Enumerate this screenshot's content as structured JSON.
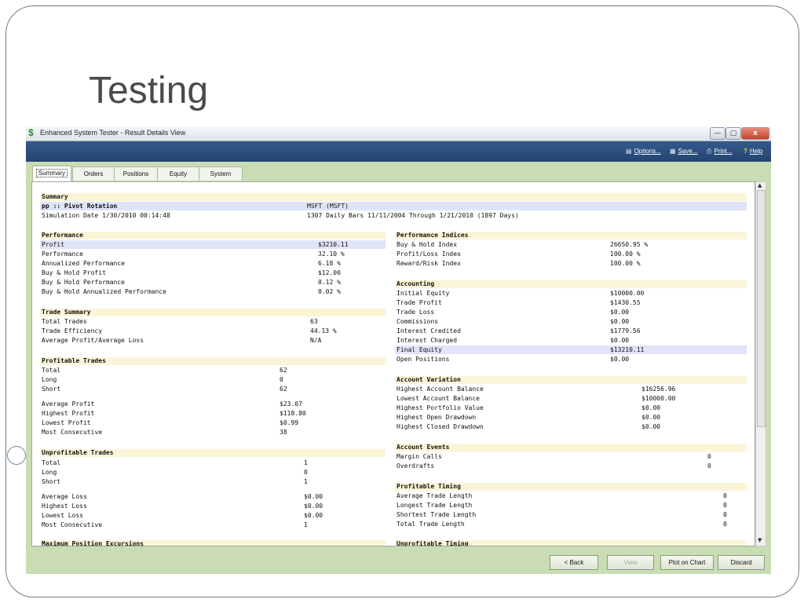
{
  "slide": {
    "title": "Testing"
  },
  "window": {
    "title": "Enhanced System Tester - Result Details View",
    "app_icon": "$",
    "buttons": {
      "minimize": "—",
      "maximize": "▢",
      "close": "x"
    }
  },
  "toolbar": {
    "options": "Options...",
    "save": "Save...",
    "print": "Print...",
    "help": "Help"
  },
  "tabs": [
    "Summary",
    "Orders",
    "Positions",
    "Equity",
    "System"
  ],
  "summary": {
    "header": "Summary",
    "system_name": "pp :: Pivot Rotation",
    "symbol": "MSFT (MSFT)",
    "sim_date": "Simulation Date 1/30/2010 00:14:48",
    "bars": "1307 Daily Bars 11/11/2004 Through 1/21/2010 (1897 Days)"
  },
  "left": {
    "performance": {
      "header": "Performance",
      "rows": [
        {
          "label": "Profit",
          "value": "$3210.11"
        },
        {
          "label": "Performance",
          "value": "32.10 %"
        },
        {
          "label": "Annualized Performance",
          "value": "6.18 %"
        },
        {
          "label": "Buy & Hold Profit",
          "value": "$12.00"
        },
        {
          "label": "Buy & Hold Performance",
          "value": "0.12 %"
        },
        {
          "label": "Buy & Hold Annualized Performance",
          "value": "0.02 %"
        }
      ]
    },
    "trade_summary": {
      "header": "Trade Summary",
      "rows": [
        {
          "label": "Total Trades",
          "value": "63"
        },
        {
          "label": "Trade Efficiency",
          "value": "44.13 %"
        },
        {
          "label": "Average Profit/Average Loss",
          "value": "N/A"
        }
      ]
    },
    "profitable_trades": {
      "header": "Profitable Trades",
      "rows": [
        {
          "label": "Total",
          "value": "62"
        },
        {
          "label": "Long",
          "value": "0"
        },
        {
          "label": "Short",
          "value": "62"
        },
        {
          "label": "Average Profit",
          "value": "$23.07"
        },
        {
          "label": "Highest Profit",
          "value": "$118.80"
        },
        {
          "label": "Lowest Profit",
          "value": "$0.99"
        },
        {
          "label": "Most Consecutive",
          "value": "38"
        }
      ]
    },
    "unprofitable_trades": {
      "header": "Unprofitable Trades",
      "rows": [
        {
          "label": "Total",
          "value": "1"
        },
        {
          "label": "Long",
          "value": "0"
        },
        {
          "label": "Short",
          "value": "1"
        },
        {
          "label": "Average Loss",
          "value": "$0.00"
        },
        {
          "label": "Highest Loss",
          "value": "$0.00"
        },
        {
          "label": "Lowest Loss",
          "value": "$0.00"
        },
        {
          "label": "Most Consecutive",
          "value": "1"
        }
      ]
    },
    "cut_header": "Maximum Position Excursions"
  },
  "right": {
    "performance_indices": {
      "header": "Performance Indices",
      "rows": [
        {
          "label": "Buy & Hold Index",
          "value": "26650.95 %"
        },
        {
          "label": "Profit/Loss Index",
          "value": "100.00 %"
        },
        {
          "label": "Reward/Risk Index",
          "value": "100.00 %"
        }
      ]
    },
    "accounting": {
      "header": "Accounting",
      "rows": [
        {
          "label": "Initial Equity",
          "value": "$10000.00"
        },
        {
          "label": "Trade Profit",
          "value": "$1430.55"
        },
        {
          "label": "Trade Loss",
          "value": "$0.00"
        },
        {
          "label": "Commissions",
          "value": "$0.00"
        },
        {
          "label": "Interest Credited",
          "value": "$1779.56"
        },
        {
          "label": "Interest Charged",
          "value": "$0.00"
        },
        {
          "label": "Final Equity",
          "value": "$13210.11"
        },
        {
          "label": "Open Positions",
          "value": "$0.00"
        }
      ]
    },
    "account_variation": {
      "header": "Account Variation",
      "rows": [
        {
          "label": "Highest Account Balance",
          "value": "$16256.96"
        },
        {
          "label": "Lowest Account Balance",
          "value": "$10000.00"
        },
        {
          "label": "Highest Portfolio Value",
          "value": "$0.00"
        },
        {
          "label": "Highest Open Drawdown",
          "value": "$0.00"
        },
        {
          "label": "Highest Closed Drawdown",
          "value": "$0.00"
        }
      ]
    },
    "account_events": {
      "header": "Account Events",
      "rows": [
        {
          "label": "Margin Calls",
          "value": "0"
        },
        {
          "label": "Overdrafts",
          "value": "0"
        }
      ]
    },
    "profitable_timing": {
      "header": "Profitable Timing",
      "rows": [
        {
          "label": "Average Trade Length",
          "value": "0"
        },
        {
          "label": "Longest Trade Length",
          "value": "0"
        },
        {
          "label": "Shortest Trade Length",
          "value": "0"
        },
        {
          "label": "Total Trade Length",
          "value": "0"
        }
      ]
    },
    "cut_header": "Unprofitable Timing"
  },
  "footer": {
    "back": "< Back",
    "view": "View",
    "plot": "Plot on Chart",
    "discard": "Discard"
  }
}
